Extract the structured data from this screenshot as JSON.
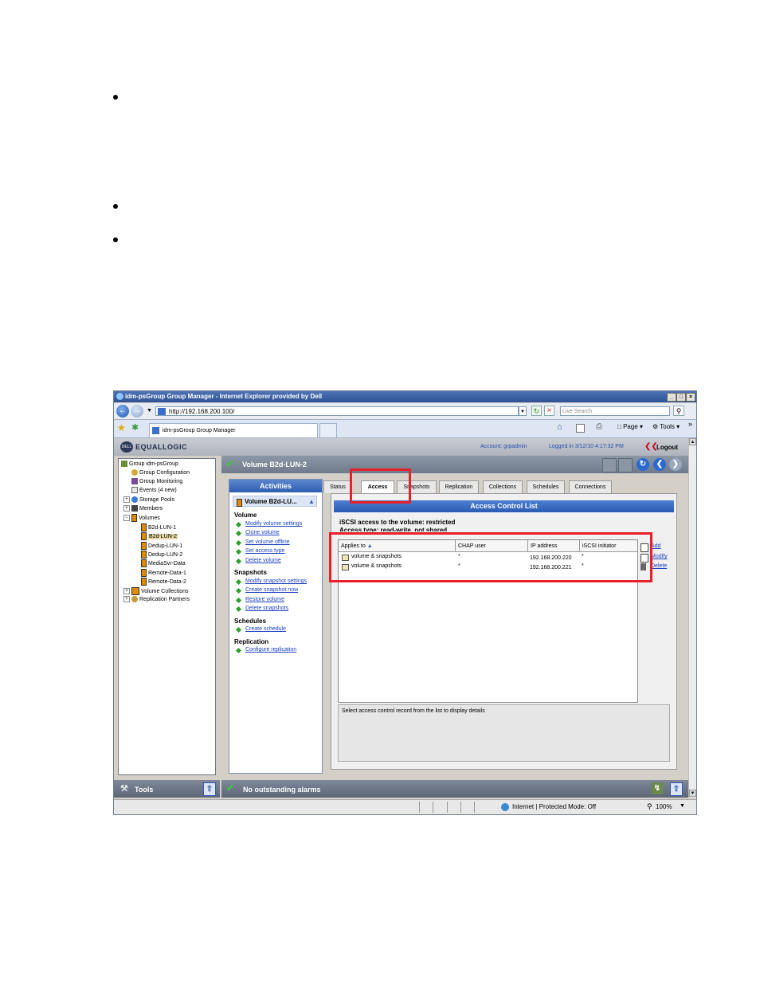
{
  "window": {
    "title": "idm-psGroup Group Manager - Internet Explorer provided by Dell",
    "buttons": [
      "_",
      "□",
      "×"
    ]
  },
  "browser": {
    "url": "http://192.168.200.100/",
    "search_placeholder": "Live Search",
    "tab_title": "idm-psGroup Group Manager",
    "page_menu": "Page",
    "tools_menu": "Tools"
  },
  "header": {
    "logo": "EQUALLOGIC",
    "dell": "DELL",
    "account": "Account: grpadmin",
    "logged_in": "Logged in 3/12/10 4:17:32 PM",
    "logout": "Logout"
  },
  "tree": {
    "items": [
      {
        "label": "Group idm-psGroup",
        "level": 0
      },
      {
        "label": "Group Configuration",
        "level": 1
      },
      {
        "label": "Group Monitoring",
        "level": 1
      },
      {
        "label": "Events (4 new)",
        "level": 1
      },
      {
        "label": "Storage Pools",
        "level": 1
      },
      {
        "label": "Members",
        "level": 1
      },
      {
        "label": "Volumes",
        "level": 1
      },
      {
        "label": "B2d-LUN-1",
        "level": 2
      },
      {
        "label": "B2d-LUN-2",
        "level": 2
      },
      {
        "label": "Dedup-LUN-1",
        "level": 2
      },
      {
        "label": "Dedup-LUN-2",
        "level": 2
      },
      {
        "label": "MediaSvr-Data",
        "level": 2
      },
      {
        "label": "Remote-Data-1",
        "level": 2
      },
      {
        "label": "Remote-Data-2",
        "level": 2
      },
      {
        "label": "Volume Collections",
        "level": 1
      },
      {
        "label": "Replication Partners",
        "level": 1
      }
    ]
  },
  "volume_header": {
    "title": "Volume B2d-LUN-2"
  },
  "activities": {
    "title": "Activities",
    "selected": "Volume B2d-LU...",
    "sections": [
      {
        "title": "Volume",
        "links": [
          "Modify volume settings",
          "Clone volume",
          "Set volume offline",
          "Set access type",
          "Delete volume"
        ]
      },
      {
        "title": "Snapshots",
        "links": [
          "Modify snapshot settings",
          "Create snapshot now",
          "Restore volume",
          "Delete snapshots"
        ]
      },
      {
        "title": "Schedules",
        "links": [
          "Create schedule"
        ]
      },
      {
        "title": "Replication",
        "links": [
          "Configure replication"
        ]
      }
    ]
  },
  "tabs": [
    "Status",
    "Access",
    "Snapshots",
    "Replication",
    "Collections",
    "Schedules",
    "Connections"
  ],
  "acl": {
    "title": "Access Control List",
    "access_line": "iSCSI access to the volume: restricted",
    "access_type": "Access type: read-write, not shared",
    "columns": [
      "Applies to",
      "CHAP user",
      "IP address",
      "iSCSI initiator"
    ],
    "rows": [
      [
        "volume & snapshots",
        "*",
        "192.168.200.220",
        "*"
      ],
      [
        "volume & snapshots",
        "*",
        "192.168.200.221",
        "*"
      ]
    ],
    "side_actions": [
      "Add",
      "Modify",
      "Delete"
    ],
    "detail_text": "Select access control record from the list to display details"
  },
  "bottom": {
    "tools": "Tools",
    "alarms": "No outstanding alarms"
  },
  "status": {
    "zone": "Internet | Protected Mode: Off",
    "zoom": "100%"
  },
  "colors": {
    "highlight": "#e8202a",
    "titlebar": "#2e5293",
    "link": "#1a3fbf"
  }
}
